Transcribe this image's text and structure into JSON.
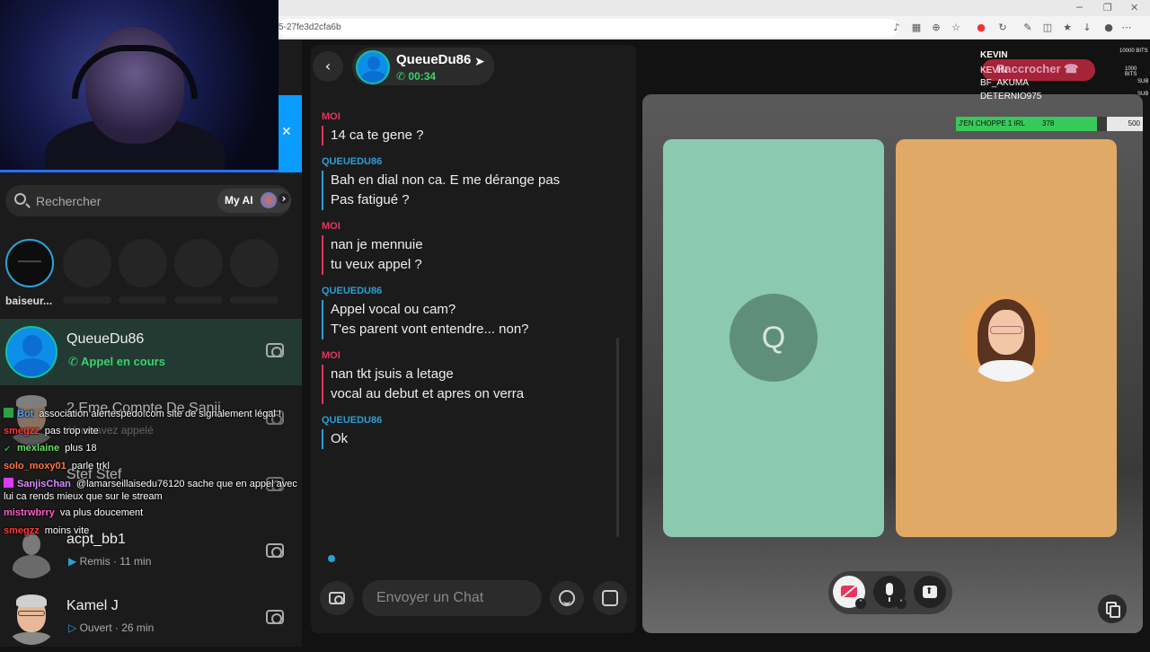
{
  "browser": {
    "url_fragment": "5-27fe3d2cfa6b"
  },
  "search": {
    "placeholder": "Rechercher",
    "my_ai_label": "My AI"
  },
  "stories": {
    "first_label": "baiseur..."
  },
  "friends": [
    {
      "name": "QueueDu86",
      "status": "Appel en cours"
    },
    {
      "name": "2 Eme Compte De Sanji",
      "status": "Vous avez appelé"
    },
    {
      "name": "Stef Stef",
      "status": ""
    },
    {
      "name": "acpt_bb1",
      "status": "Remis · 11 min"
    },
    {
      "name": "Kamel J",
      "status": "Ouvert · 26 min"
    }
  ],
  "chat": {
    "contact_name": "QueueDu86",
    "call_timer": "00:34",
    "messages": [
      {
        "sender": "MOI",
        "lines": [
          "14 ca te gene ?"
        ]
      },
      {
        "sender": "QUEUEDU86",
        "lines": [
          "Bah en dial non ca. E me dérange pas",
          "Pas fatigué ?"
        ]
      },
      {
        "sender": "MOI",
        "lines": [
          "nan je mennuie",
          "tu veux appel ?"
        ]
      },
      {
        "sender": "QUEUEDU86",
        "lines": [
          "Appel vocal ou cam?",
          "T'es parent vont entendre... non?"
        ]
      },
      {
        "sender": "MOI",
        "lines": [
          "nan tkt jsuis a letage",
          "vocal au debut et apres on verra"
        ]
      },
      {
        "sender": "QUEUEDU86",
        "lines": [
          "Ok"
        ]
      }
    ],
    "input_placeholder": "Envoyer un Chat"
  },
  "call": {
    "remote_initial": "Q",
    "hangup_label": "Raccrocher"
  },
  "stream_overlay": {
    "top_name": "KEVIN",
    "top_bits": "10000 BITS",
    "second_bits": "1000 BITS",
    "leaderboard": [
      "KEVIN",
      "BF_AKUMA",
      "DETERNIO975"
    ],
    "sub_tag": "SUB",
    "goal_label": "J'EN CHOPPE 1 IRL",
    "goal_current": "378",
    "goal_target": "500",
    "goal_fraction": 0.756,
    "chat": [
      {
        "user": "Bot",
        "text": "association alertespedo.com site de signalement légal !",
        "color": "#4aa8ff"
      },
      {
        "user": "smegzz",
        "text": "pas trop vite",
        "color": "#ff3b3b"
      },
      {
        "user": "mexlaine",
        "text": "plus 18",
        "color": "#6be06b"
      },
      {
        "user": "solo_moxy01",
        "text": "parle trkl",
        "color": "#ff7a3b"
      },
      {
        "user": "SanjisChan",
        "text": "@lamarseillaisedu76120 sache que en appel avec",
        "color": "#d98cff"
      },
      {
        "user": "",
        "text": "lui ca rends mieux que sur le stream",
        "color": "#ffffff"
      },
      {
        "user": "mistrwbrry",
        "text": "va plus doucement",
        "color": "#ff5ac8"
      },
      {
        "user": "smegzz",
        "text": "moins vite",
        "color": "#ff3b3b"
      }
    ]
  },
  "colors": {
    "snap_blue": "#2a9fd8",
    "snap_red": "#e8345c",
    "call_green": "#39d36a",
    "teal_tile": "#8cc9b1",
    "gold_tile": "#e0a966"
  }
}
